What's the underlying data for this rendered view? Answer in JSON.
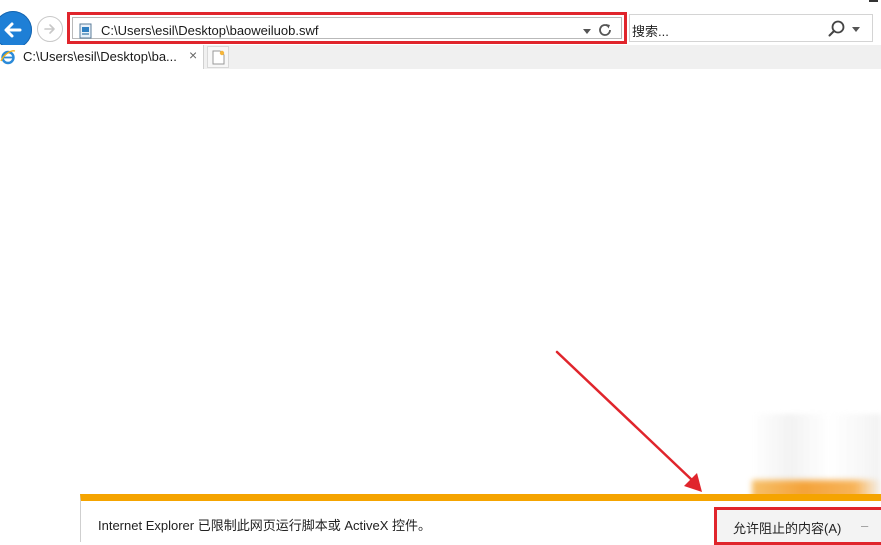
{
  "toolbar": {
    "address_url": "C:\\Users\\esil\\Desktop\\baoweiluob.swf",
    "search_placeholder": "搜索..."
  },
  "tabs": [
    {
      "title": "C:\\Users\\esil\\Desktop\\ba...",
      "close_glyph": "×",
      "active": true
    }
  ],
  "notification": {
    "message": "Internet Explorer 已限制此网页运行脚本或 ActiveX 控件。",
    "allow_button_label": "允许阻止的内容(A)",
    "dismiss_glyph": "–"
  },
  "icons": {
    "back": "back-arrow-icon",
    "forward": "forward-arrow-icon",
    "page": "page-file-icon",
    "refresh": "refresh-icon",
    "search": "search-icon",
    "ie": "ie-logo-icon",
    "new_tab": "new-tab-icon"
  },
  "colors": {
    "annotation_red": "#e0252c",
    "notification_bar": "#f5a400",
    "back_button": "#1e7fd6"
  }
}
